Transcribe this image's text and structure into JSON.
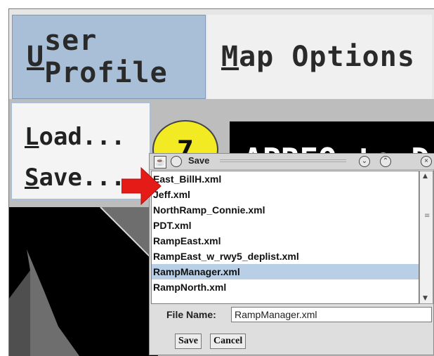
{
  "menubar": {
    "user_profile": {
      "first": "U",
      "rest": "ser Profile"
    },
    "map_options": {
      "first": "M",
      "rest": "ap Options"
    }
  },
  "user_profile_menu": {
    "load": {
      "first": "L",
      "rest": "oad..."
    },
    "save": {
      "first": "S",
      "rest": "ave..."
    }
  },
  "badge_text": "7",
  "banner_text": "APREQ to D",
  "dialog": {
    "title": "Save",
    "files": [
      "East_BillH.xml",
      "Jeff.xml",
      "NorthRamp_Connie.xml",
      "PDT.xml",
      "RampEast.xml",
      "RampEast_w_rwy5_deplist.xml",
      "RampManager.xml",
      "RampNorth.xml"
    ],
    "selected_file": "RampManager.xml",
    "file_name_label": "File Name:",
    "file_name_value": "RampManager.xml",
    "save_button": "Save",
    "cancel_button": "Cancel"
  },
  "colors": {
    "menu_selected": "#a9bfd8",
    "list_selection": "#b8cfe6",
    "badge": "#f2ea22",
    "arrow": "#e51b17"
  },
  "icons": {
    "arrow": "red-pointer-arrow-icon",
    "java": "java-app-icon",
    "minimize": "circle-minimize-icon",
    "collapse": "chevron-down-icon",
    "expand": "chevron-up-icon",
    "close": "close-icon"
  }
}
